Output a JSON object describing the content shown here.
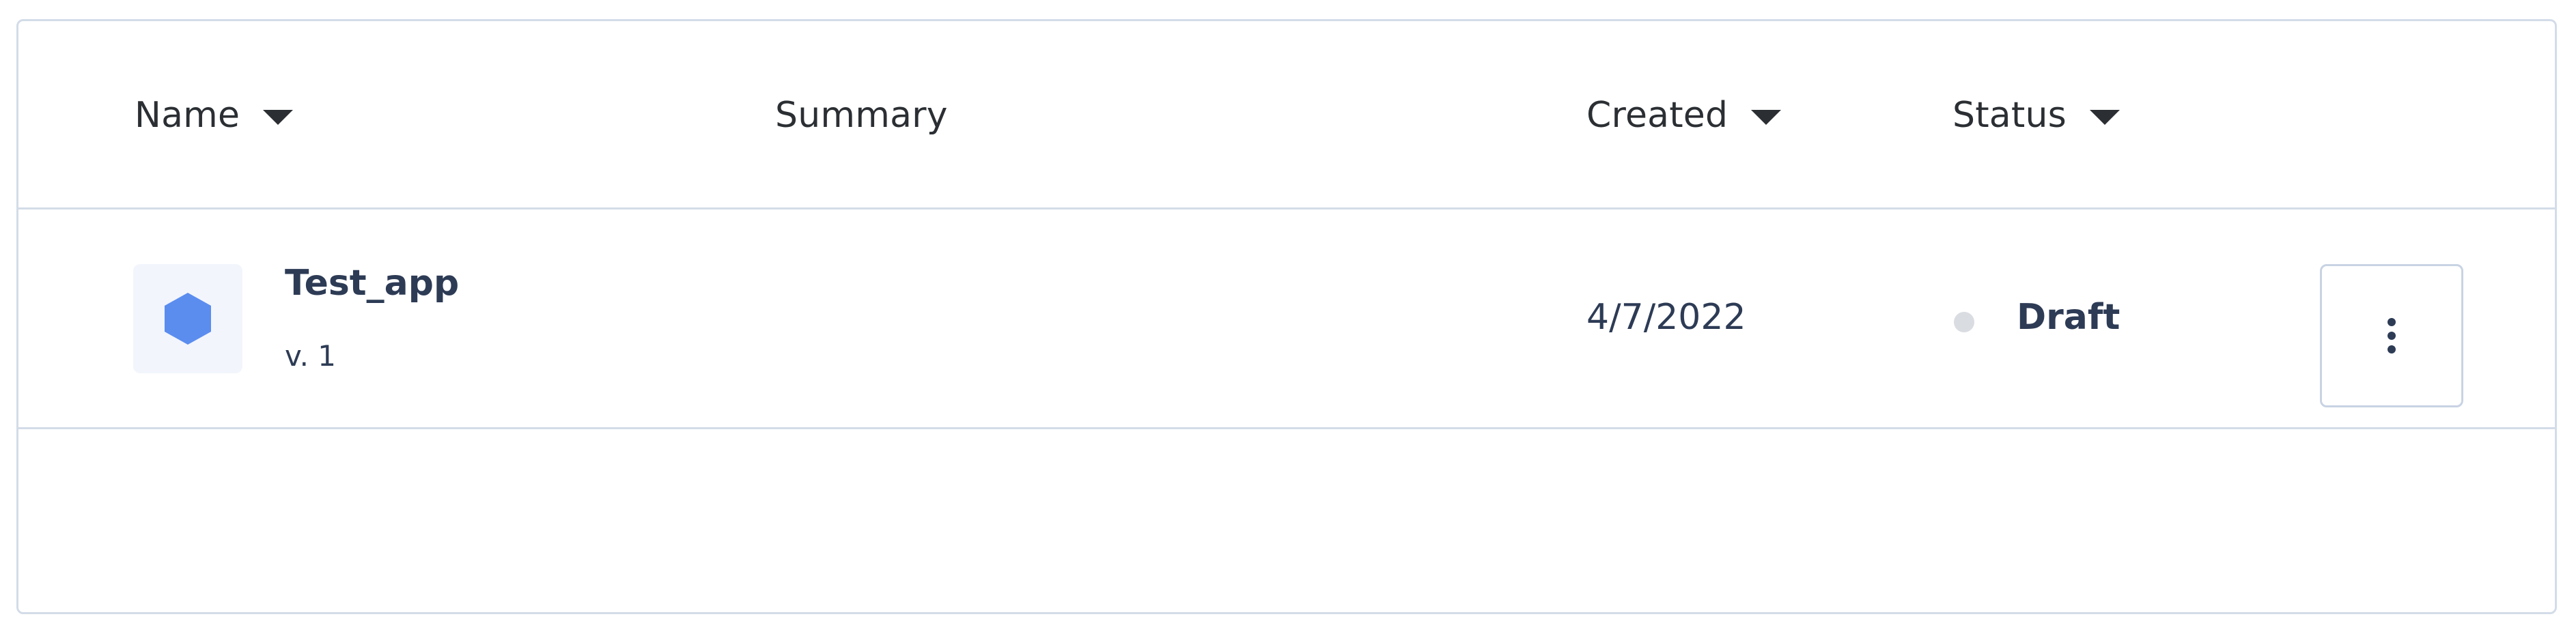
{
  "table": {
    "columns": {
      "name": "Name",
      "summary": "Summary",
      "created": "Created",
      "status": "Status"
    },
    "sortable_icon": "caret-down-icon",
    "rows": [
      {
        "icon": "hexagon-icon",
        "icon_color": "#5b8def",
        "name": "Test_app",
        "version": "v. 1",
        "summary": "",
        "created": "4/7/2022",
        "status": "Draft",
        "status_dot_color": "#d9dce1",
        "actions_icon": "kebab-menu-icon"
      }
    ]
  },
  "colors": {
    "border": "#d3dce8",
    "text_primary": "#2d3b55",
    "header_text": "#2b2f33",
    "tile_background": "#f2f5fc"
  }
}
